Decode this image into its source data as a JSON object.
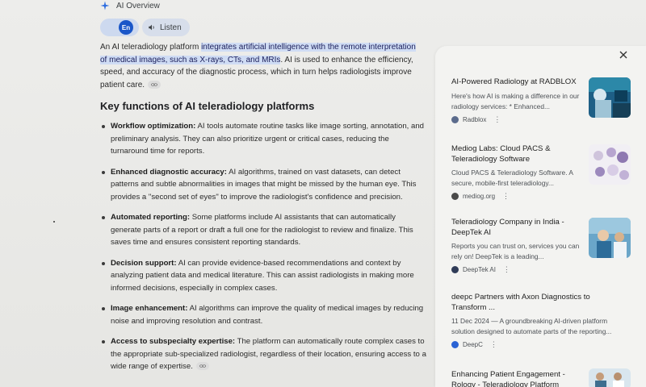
{
  "ai_overview": {
    "label": "AI Overview",
    "lang_toggle": "En",
    "listen_label": "Listen"
  },
  "intro": {
    "pre": "An AI teleradiology platform ",
    "highlight": "integrates artificial intelligence with the remote interpretation of medical images, such as X-rays, CTs, and MRIs",
    "post": ". AI is used to enhance the efficiency, speed, and accuracy of the diagnostic process, which in turn helps radiologists improve patient care."
  },
  "section_title": "Key functions of AI teleradiology platforms",
  "functions": [
    {
      "term": "Workflow optimization:",
      "text": " AI tools automate routine tasks like image sorting, annotation, and preliminary analysis. They can also prioritize urgent or critical cases, reducing the turnaround time for reports."
    },
    {
      "term": "Enhanced diagnostic accuracy:",
      "text": " AI algorithms, trained on vast datasets, can detect patterns and subtle abnormalities in images that might be missed by the human eye. This provides a \"second set of eyes\" to improve the radiologist's confidence and precision."
    },
    {
      "term": "Automated reporting:",
      "text": " Some platforms include AI assistants that can automatically generate parts of a report or draft a full one for the radiologist to review and finalize. This saves time and ensures consistent reporting standards."
    },
    {
      "term": "Decision support:",
      "text": " AI can provide evidence-based recommendations and context by analyzing patient data and medical literature. This can assist radiologists in making more informed decisions, especially in complex cases."
    },
    {
      "term": "Image enhancement:",
      "text": " AI algorithms can improve the quality of medical images by reducing noise and improving resolution and contrast."
    },
    {
      "term": "Access to subspecialty expertise:",
      "text": " The platform can automatically route complex cases to the appropriate sub-specialized radiologist, regardless of their location, ensuring access to a wide range of expertise."
    }
  ],
  "sources": [
    {
      "title": "AI-Powered Radiology at RADBLOX",
      "snippet": "Here's how AI is making a difference in our radiology services: * Enhanced...",
      "site": "Radblox",
      "favicon_color": "#5b6b8c",
      "date": ""
    },
    {
      "title": "Mediog Labs: Cloud PACS & Teleradiology Software",
      "snippet": "Cloud PACS & Teleradiology Software. A secure, mobile-first teleradiology...",
      "site": "mediog.org",
      "favicon_color": "#4a4a4a",
      "date": ""
    },
    {
      "title": "Teleradiology Company in India - DeepTek AI",
      "snippet": "Reports you can trust on, services you can rely on! DeepTek is a leading...",
      "site": "DeepTek AI",
      "favicon_color": "#2f3b57",
      "date": ""
    },
    {
      "title": "deepc Partners with Axon Diagnostics to Transform ...",
      "snippet": "A groundbreaking AI-driven platform solution designed to automate parts of the reporting...",
      "site": "DeepC",
      "favicon_color": "#2a63d4",
      "date": "11 Dec 2024"
    },
    {
      "title": "Enhancing Patient Engagement - Rology - Teleradiology Platform",
      "snippet": "",
      "site": "",
      "favicon_color": "#888888",
      "date": ""
    }
  ],
  "colors": {
    "highlight_bg": "#cfdcf4",
    "accent": "#1a56c8",
    "panel_bg": "#f3f3f1"
  },
  "icons": {
    "spark": "sparkle-icon",
    "listen": "speaker-icon",
    "link": "link-icon",
    "close": "close-icon",
    "more": "more-vert-icon"
  }
}
